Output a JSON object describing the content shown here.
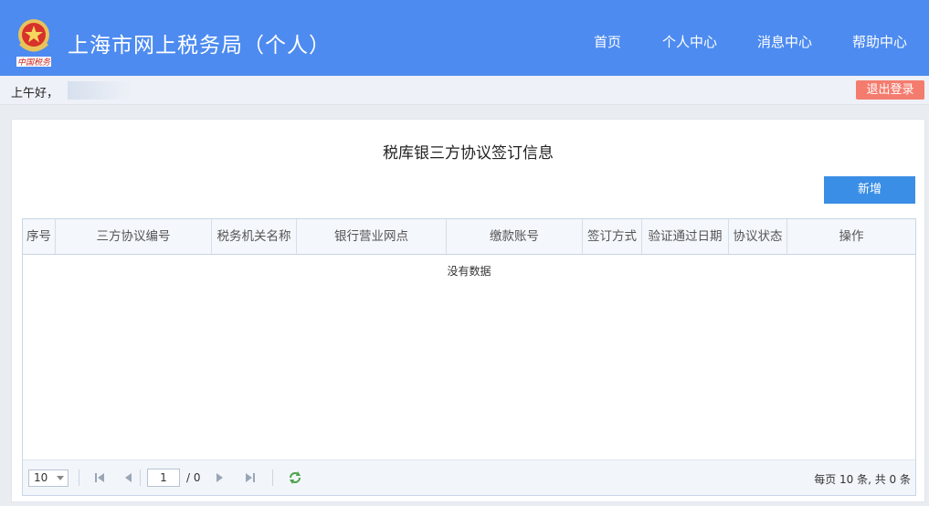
{
  "header": {
    "site_title": "上海市网上税务局（个人）",
    "emblem_caption": "中国税务",
    "nav": [
      {
        "label": "首页"
      },
      {
        "label": "个人中心"
      },
      {
        "label": "消息中心"
      },
      {
        "label": "帮助中心"
      }
    ]
  },
  "greeting": {
    "text": "上午好，",
    "logout_label": "退出登录"
  },
  "page": {
    "title": "税库银三方协议签订信息",
    "add_button_label": "新增"
  },
  "table": {
    "columns": [
      "序号",
      "三方协议编号",
      "税务机关名称",
      "银行营业网点",
      "缴款账号",
      "签订方式",
      "验证通过日期",
      "协议状态",
      "操作"
    ],
    "empty_message": "没有数据"
  },
  "pager": {
    "page_size": "10",
    "current_page": "1",
    "total_pages": "/ 0",
    "info": "每页 10 条, 共 0 条"
  },
  "colors": {
    "header_bg": "#4d8bf0",
    "logout_bg": "#f47c6e",
    "primary_button": "#3a8ee6"
  }
}
